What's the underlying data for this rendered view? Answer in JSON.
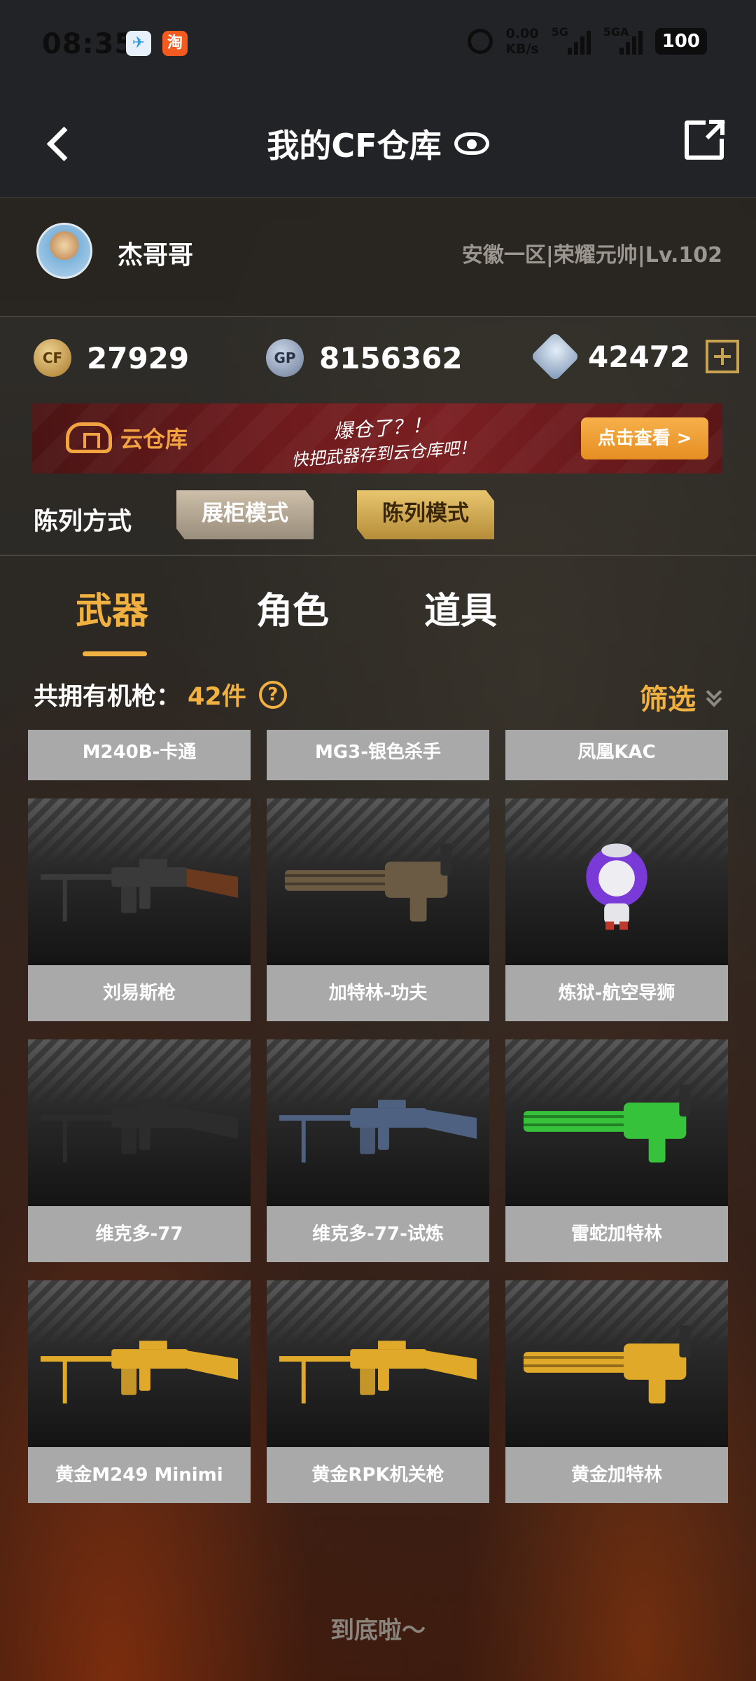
{
  "status_bar": {
    "time": "08:35",
    "net_speed_value": "0.00",
    "net_speed_unit": "KB/s",
    "signal1_label": "5G",
    "signal2_label": "5GA",
    "battery": "100",
    "apps": [
      "telegram-icon",
      "taobao-icon"
    ],
    "taobao_char": "淘"
  },
  "header": {
    "title": "我的CF仓库"
  },
  "profile": {
    "username": "杰哥哥",
    "server_info": "安徽一区|荣耀元帅|Lv.102"
  },
  "currency": {
    "cf_points": "27929",
    "gp": "8156362",
    "gp_icon_label": "GP",
    "diamonds": "42472"
  },
  "banner": {
    "label": "云仓库",
    "line1": "爆仓了？！",
    "line2": "快把武器存到云仓库吧！",
    "button": "点击查看 >"
  },
  "display_mode": {
    "label": "陈列方式",
    "options": [
      "展柜模式",
      "陈列模式"
    ],
    "selected": "陈列模式"
  },
  "tabs": [
    {
      "label": "武器",
      "active": true
    },
    {
      "label": "角色",
      "active": false
    },
    {
      "label": "道具",
      "active": false
    }
  ],
  "summary": {
    "prefix": "共拥有机枪：",
    "count": "42件",
    "filter_label": "筛选"
  },
  "weapons": [
    {
      "name": "M240B-卡通",
      "color": "#c9a64a"
    },
    {
      "name": "MG3-银色杀手",
      "color": "#9a9a9a"
    },
    {
      "name": "凤凰KAC",
      "color": "#c9a64a"
    },
    {
      "name": "刘易斯枪",
      "color": "#3a3a3a"
    },
    {
      "name": "加特林-功夫",
      "color": "#6b5a44"
    },
    {
      "name": "炼狱-航空导狮",
      "color": "#7a3ad8"
    },
    {
      "name": "维克多-77",
      "color": "#2c2c2c"
    },
    {
      "name": "维克多-77-试炼",
      "color": "#4f6180"
    },
    {
      "name": "雷蛇加特林",
      "color": "#36c23a"
    },
    {
      "name": "黄金M249  Minimi",
      "color": "#e0a92a"
    },
    {
      "name": "黄金RPK机关枪",
      "color": "#e0a92a"
    },
    {
      "name": "黄金加特林",
      "color": "#e0a92a"
    }
  ],
  "footer": {
    "end_text": "到底啦～"
  }
}
